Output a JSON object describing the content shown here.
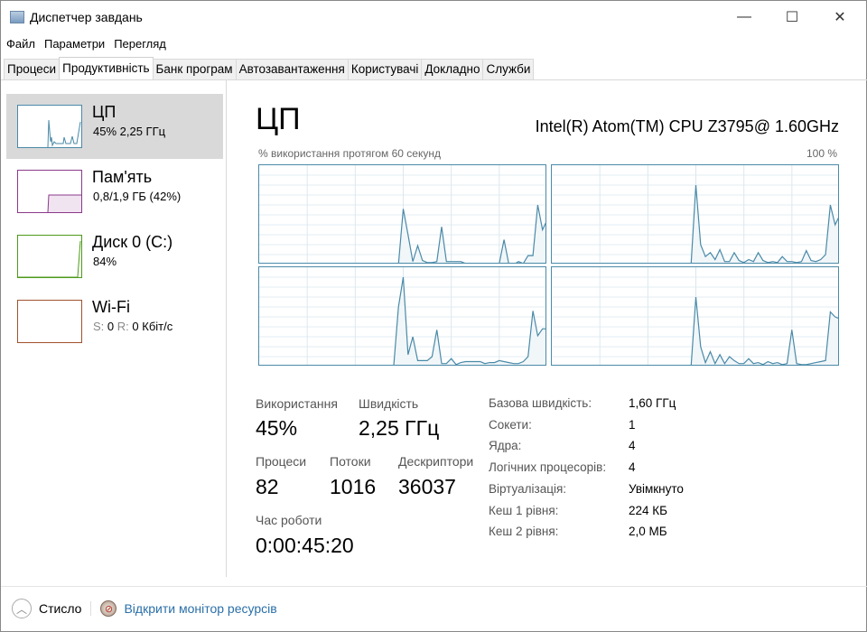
{
  "window": {
    "title": "Диспетчер завдань",
    "minimize": "—",
    "maximize": "☐",
    "close": "✕"
  },
  "menu": [
    "Файл",
    "Параметри",
    "Перегляд"
  ],
  "tabs": [
    "Процеси",
    "Продуктивність",
    "Банк програм",
    "Автозавантаження",
    "Користувачі",
    "Докладно",
    "Служби"
  ],
  "active_tab": 1,
  "sidebar": [
    {
      "name": "ЦП",
      "sub": "45%  2,25 ГГц",
      "color": "#4a8aa8"
    },
    {
      "name": "Пам'ять",
      "sub": "0,8/1,9 ГБ (42%)",
      "color": "#8b3a8b"
    },
    {
      "name": "Диск 0 (C:)",
      "sub": "84%",
      "color": "#4d9a1a"
    },
    {
      "name": "Wi-Fi",
      "sub_s": "S:",
      "sub_s_val": "0",
      "sub_r": "R:",
      "sub_r_val": "0 Кбіт/с",
      "color": "#a0522d"
    }
  ],
  "main": {
    "title": "ЦП",
    "cpu_model": "Intel(R) Atom(TM) CPU Z3795@ 1.60GHz",
    "graph_label": "% використання протягом 60 секунд",
    "graph_max": "100 %",
    "stats": {
      "usage_label": "Використання",
      "usage": "45%",
      "speed_label": "Швидкість",
      "speed": "2,25 ГГц",
      "processes_label": "Процеси",
      "processes": "82",
      "threads_label": "Потоки",
      "threads": "1016",
      "handles_label": "Дескриптори",
      "handles": "36037",
      "uptime_label": "Час роботи",
      "uptime": "0:00:45:20"
    },
    "details": [
      {
        "k": "Базова швидкість:",
        "v": "1,60 ГГц"
      },
      {
        "k": "Сокети:",
        "v": "1"
      },
      {
        "k": "Ядра:",
        "v": "4"
      },
      {
        "k": "Логічних процесорів:",
        "v": "4"
      },
      {
        "k": "Віртуалізація:",
        "v": "Увімкнуто"
      },
      {
        "k": "Кеш 1 рівня:",
        "v": "224 КБ"
      },
      {
        "k": "Кеш 2 рівня:",
        "v": "2,0 МБ"
      }
    ]
  },
  "footer": {
    "collapse": "Стисло",
    "resmon": "Відкрити монітор ресурсів"
  },
  "chart_data": {
    "type": "line",
    "xlabel": "% використання протягом 60 секунд",
    "ylim": [
      0,
      100
    ],
    "series": [
      {
        "name": "core0",
        "values": [
          0,
          0,
          0,
          0,
          0,
          0,
          0,
          0,
          0,
          0,
          0,
          0,
          0,
          0,
          0,
          0,
          0,
          0,
          0,
          0,
          0,
          0,
          0,
          0,
          0,
          0,
          0,
          0,
          0,
          0,
          56,
          30,
          3,
          19,
          4,
          2,
          2,
          3,
          38,
          3,
          3,
          3,
          3,
          1,
          0,
          1,
          0,
          0,
          1,
          1,
          1,
          25,
          0,
          0,
          3,
          1,
          9,
          9,
          60,
          35,
          45
        ]
      },
      {
        "name": "core1",
        "values": [
          0,
          0,
          0,
          0,
          0,
          0,
          0,
          0,
          0,
          0,
          0,
          0,
          0,
          0,
          0,
          0,
          0,
          0,
          0,
          0,
          0,
          0,
          0,
          0,
          0,
          0,
          0,
          0,
          0,
          0,
          80,
          20,
          8,
          12,
          5,
          15,
          3,
          3,
          12,
          4,
          2,
          5,
          3,
          12,
          4,
          2,
          3,
          2,
          8,
          3,
          3,
          2,
          3,
          14,
          4,
          3,
          5,
          10,
          60,
          40,
          50
        ]
      },
      {
        "name": "core2",
        "values": [
          0,
          0,
          0,
          0,
          0,
          0,
          0,
          0,
          0,
          0,
          0,
          0,
          0,
          0,
          0,
          0,
          0,
          0,
          0,
          0,
          0,
          0,
          0,
          0,
          0,
          0,
          0,
          0,
          0,
          60,
          90,
          12,
          30,
          6,
          6,
          6,
          10,
          37,
          3,
          3,
          8,
          2,
          4,
          5,
          5,
          5,
          5,
          3,
          4,
          4,
          6,
          5,
          4,
          3,
          3,
          5,
          10,
          56,
          31,
          38,
          38
        ]
      },
      {
        "name": "core3",
        "values": [
          0,
          0,
          0,
          0,
          0,
          0,
          0,
          0,
          0,
          0,
          0,
          0,
          0,
          0,
          0,
          0,
          0,
          0,
          0,
          0,
          0,
          0,
          0,
          0,
          0,
          0,
          0,
          0,
          0,
          0,
          70,
          20,
          4,
          15,
          3,
          12,
          3,
          10,
          6,
          3,
          3,
          8,
          3,
          4,
          2,
          5,
          3,
          4,
          2,
          3,
          37,
          3,
          2,
          2,
          3,
          4,
          5,
          6,
          55,
          50,
          48
        ]
      }
    ]
  }
}
